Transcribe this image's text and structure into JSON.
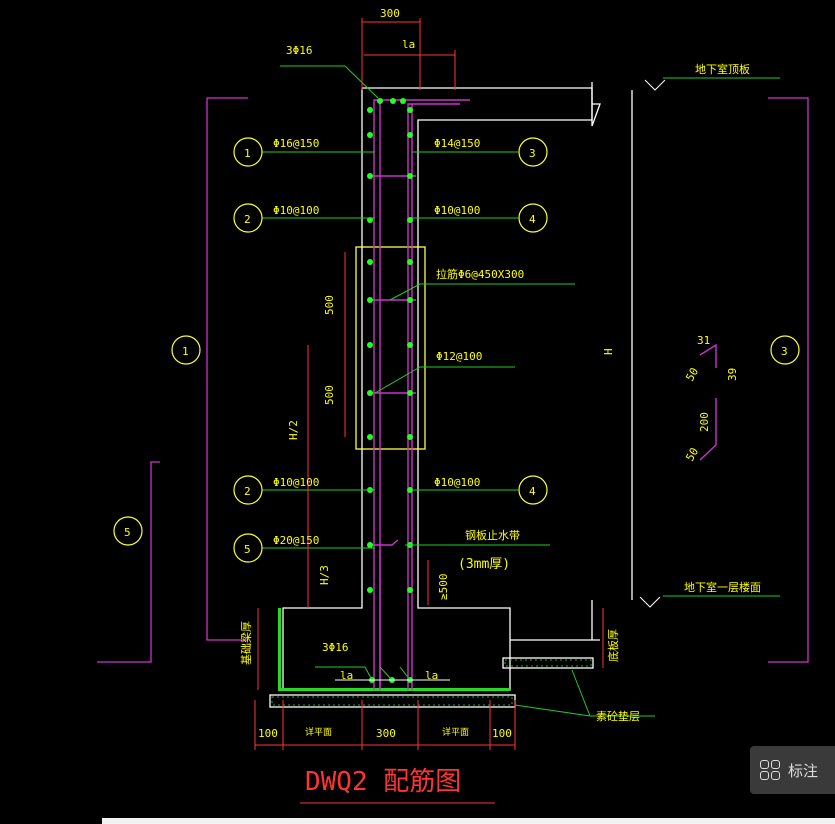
{
  "drawing": {
    "title": "DWQ2 配筋图",
    "top_labels": {
      "wall_thickness": "300",
      "la_top": "la",
      "corner_bars": "3Φ16"
    },
    "level_labels": {
      "roof": "地下室顶板",
      "floor": "地下室一层楼面"
    },
    "callouts": {
      "c1": "1",
      "c2": "2",
      "c3": "3",
      "c4": "4",
      "c5": "5",
      "left_1": "1",
      "left_5": "5",
      "right_3": "3"
    },
    "rebar_labels": {
      "r1": "Φ16@150",
      "r3": "Φ14@150",
      "r2_top": "Φ10@100",
      "r4_top": "Φ10@100",
      "tie": "拉筋Φ6@450X300",
      "add": "Φ12@100",
      "r2_bot": "Φ10@100",
      "r4_bot": "Φ10@100",
      "r5": "Φ20@150",
      "waterstop": "钢板止水带",
      "waterstop_thk": "(3mm厚)"
    },
    "dims": {
      "d500a": "500",
      "d500b": "500",
      "h2": "H/2",
      "h3": "H/3",
      "H": "H",
      "ge500": "≥500",
      "base_thk": "基础梁厚",
      "slab_thk": "底板厚",
      "cushion": "素砼垫层",
      "bars_bottom": "3Φ16",
      "la_l": "la",
      "la_r": "la",
      "d100l": "100",
      "d300": "300",
      "d100r": "100",
      "pad_l": "详平面",
      "pad_r": "详平面"
    },
    "bend_detail": {
      "a": "31",
      "b": "39",
      "c": "50",
      "d": "200",
      "e": "50"
    }
  },
  "ui": {
    "annotate_label": "标注",
    "annotate_icon": "layout-grid-icon"
  },
  "colors": {
    "background": "#000000",
    "concrete": "#ffffff",
    "rebar": "#cc33cc",
    "leader": "#22cc22",
    "text": "#ffff00",
    "dim": "#ff3333",
    "hatch": "#22dd22"
  }
}
